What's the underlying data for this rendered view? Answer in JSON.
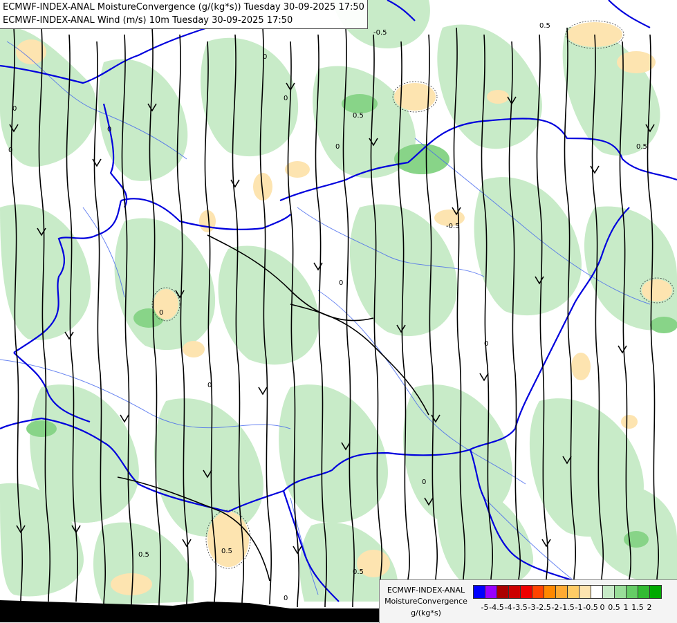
{
  "titles": {
    "line1": "ECMWF-INDEX-ANAL MoistureConvergence (g/(kg*s)) Tuesday 30-09-2025 17:50",
    "line2": "ECMWF-INDEX-ANAL Wind (m/s) 10m Tuesday 30-09-2025 17:50"
  },
  "legend": {
    "model": "ECMWF-INDEX-ANAL",
    "parameter": "MoistureConvergence",
    "unit": "g/(kg*s)",
    "swatches": [
      "#0000ff",
      "#9900ff",
      "#aa0000",
      "#cc0000",
      "#ee0000",
      "#ff4400",
      "#ff8800",
      "#ffaa33",
      "#ffcc66",
      "#fde4b0",
      "#ffffff",
      "#c8ebc8",
      "#99dd99",
      "#66cc66",
      "#33bb33",
      "#00aa00"
    ],
    "ticks": [
      "-5",
      "-4.5",
      "-4",
      "-3.5",
      "-3",
      "-2.5",
      "-2",
      "-1.5",
      "-1",
      "-0.5",
      "0",
      "0.5",
      "1",
      "1.5",
      "2"
    ]
  },
  "contour_labels": [
    "0",
    "0",
    "0",
    "0",
    "0",
    "0",
    "0",
    "0",
    "0",
    "0",
    "0",
    "0",
    "0.5",
    "0.5",
    "0.5",
    "0.5",
    "-0.5",
    "-0.5",
    "0.5",
    "0.5"
  ],
  "colors": {
    "border": "#0000dd",
    "river": "#4466ee",
    "streamline": "#000000",
    "land_green": "#c8ebc8",
    "green_mid": "#99dd99",
    "green_dark": "#66cc66",
    "convergence_orange": "#fde4b0",
    "sea": "#000000"
  }
}
